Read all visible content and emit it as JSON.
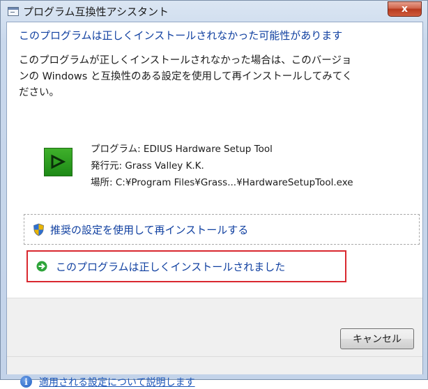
{
  "window": {
    "title": "プログラム互換性アシスタント",
    "close_label": "x"
  },
  "main": {
    "heading": "このプログラムは正しくインストールされなかった可能性があります",
    "body_lines": [
      "このプログラムが正しくインストールされなかった場合は、このバージョ",
      "ンの Windows と互換性のある設定を使用して再インストールしてみてく",
      "ださい。"
    ],
    "program": {
      "icon": "play-icon",
      "name_line": "プログラム: EDIUS Hardware Setup Tool",
      "publisher_line": "発行元: Grass Valley K.K.",
      "location_line": "場所: C:¥Program Files¥Grass...¥HardwareSetupTool.exe"
    },
    "options": [
      {
        "icon": "uac-shield-icon",
        "label": "推奨の設定を使用して再インストールする"
      },
      {
        "icon": "green-arrow-icon",
        "label": "このプログラムは正しくインストールされました",
        "highlight_color": "#d9282f"
      }
    ]
  },
  "footer": {
    "cancel_label": "キャンセル",
    "help_icon": "info-icon",
    "help_link": "適用される設定について説明します"
  },
  "colors": {
    "heading": "#0f3fa0",
    "link": "#1a55b8",
    "highlight": "#d9282f"
  }
}
